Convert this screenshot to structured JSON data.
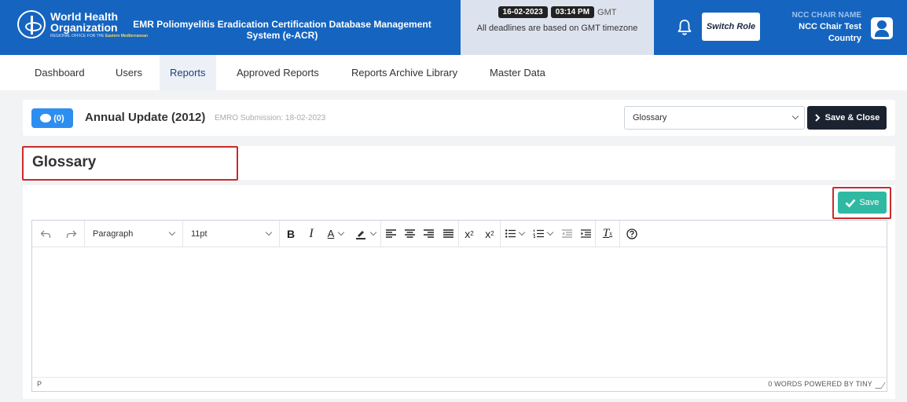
{
  "header": {
    "logo_line1": "World Health",
    "logo_line2": "Organization",
    "logo_line3_prefix": "REGIONAL OFFICE FOR THE",
    "logo_line3_region": "Eastern Mediterranean",
    "system_title": "EMR Poliomyelitis Eradication Certification Database Management System (e-ACR)",
    "date": "16-02-2023",
    "time": "03:14 PM",
    "timezone": "GMT",
    "deadline_note": "All deadlines are based on GMT timezone",
    "switch_role_label": "Switch Role",
    "user_role": "NCC CHAIR NAME",
    "user_name": "NCC Chair Test",
    "user_country": "Country"
  },
  "nav": {
    "items": [
      "Dashboard",
      "Users",
      "Reports",
      "Approved Reports",
      "Reports Archive Library",
      "Master Data"
    ],
    "active": "Reports"
  },
  "report": {
    "comment_count": "(0)",
    "title": "Annual Update (2012)",
    "submission": "EMRO Submission: 18-02-2023",
    "section_select": "Glossary",
    "save_close_label": "Save & Close"
  },
  "section": {
    "title": "Glossary",
    "save_label": "Save"
  },
  "editor": {
    "block_format": "Paragraph",
    "font_size": "11pt",
    "status_path": "P",
    "status_right": "0 WORDS  POWERED BY TINY"
  },
  "colors": {
    "header_bg": "#1565c0",
    "accent_save": "#2fb9a3",
    "highlight": "#c92b2b",
    "dark_button": "#1b2230"
  }
}
